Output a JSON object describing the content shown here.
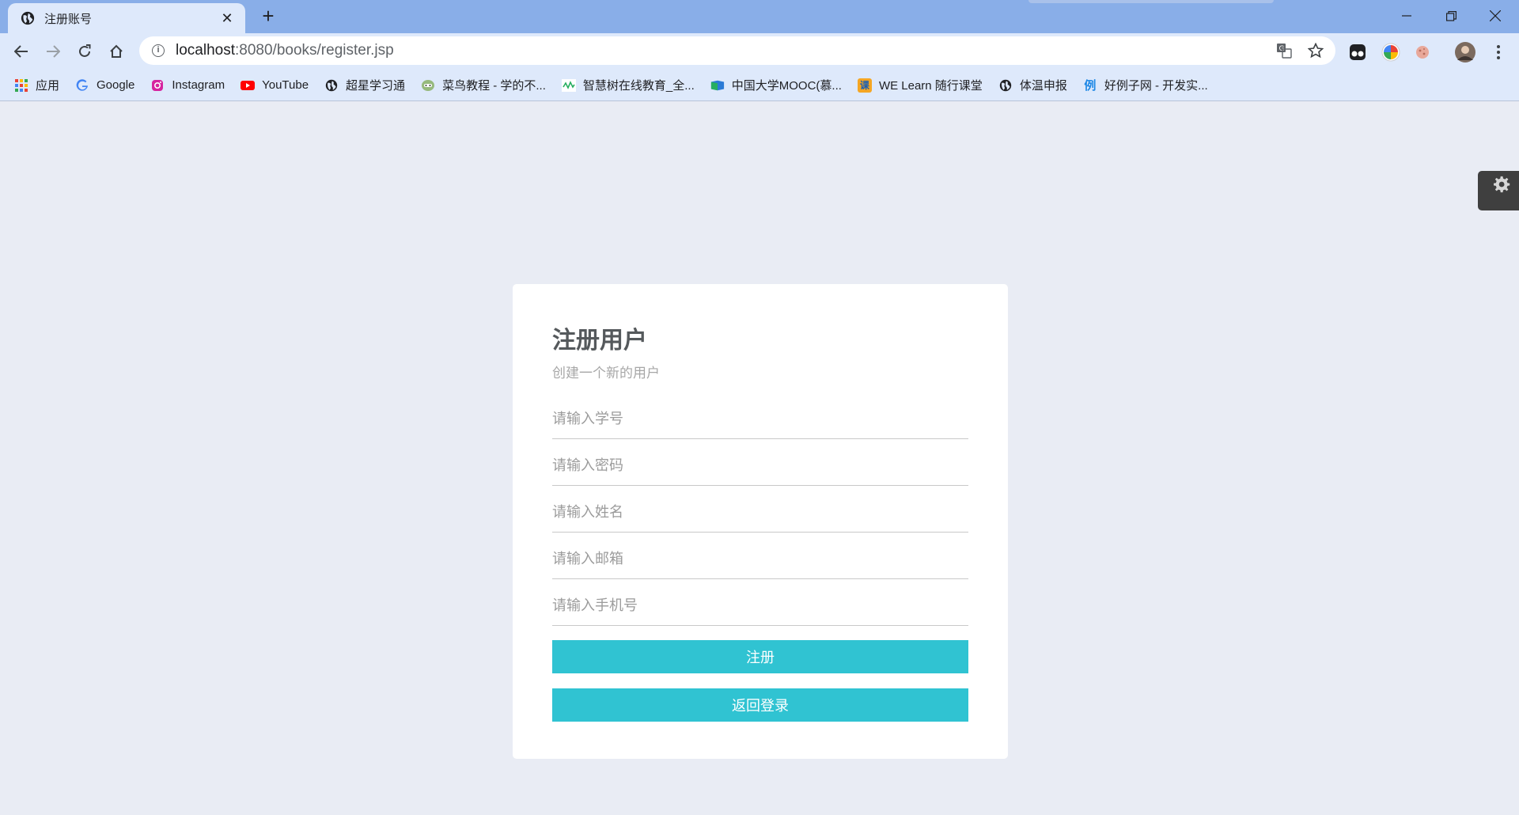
{
  "browser": {
    "tab_title": "注册账号",
    "new_tab": "+",
    "url_host": "localhost",
    "url_rest": ":8080/books/register.jsp",
    "bookmarks": [
      {
        "label": "应用",
        "icon": "apps-grid-icon"
      },
      {
        "label": "Google",
        "icon": "google-icon"
      },
      {
        "label": "Instagram",
        "icon": "instagram-icon"
      },
      {
        "label": "YouTube",
        "icon": "youtube-icon"
      },
      {
        "label": "超星学习通",
        "icon": "globe-icon"
      },
      {
        "label": "菜鸟教程 - 学的不...",
        "icon": "runoob-icon"
      },
      {
        "label": "智慧树在线教育_全...",
        "icon": "zhihuishu-icon"
      },
      {
        "label": "中国大学MOOC(慕...",
        "icon": "mooc-icon"
      },
      {
        "label": "WE Learn 随行课堂",
        "icon": "welearn-icon"
      },
      {
        "label": "体温申报",
        "icon": "globe-icon"
      },
      {
        "label": "好例子网 - 开发实...",
        "icon": "haolizi-icon"
      }
    ]
  },
  "register": {
    "title": "注册用户",
    "subtitle": "创建一个新的用户",
    "fields": [
      {
        "placeholder": "请输入学号"
      },
      {
        "placeholder": "请输入密码"
      },
      {
        "placeholder": "请输入姓名"
      },
      {
        "placeholder": "请输入邮箱"
      },
      {
        "placeholder": "请输入手机号"
      }
    ],
    "register_button": "注册",
    "back_button": "返回登录"
  },
  "colors": {
    "accent": "#30c3d2",
    "page_bg": "#e9ecf4",
    "tab_strip": "#89aee8"
  }
}
